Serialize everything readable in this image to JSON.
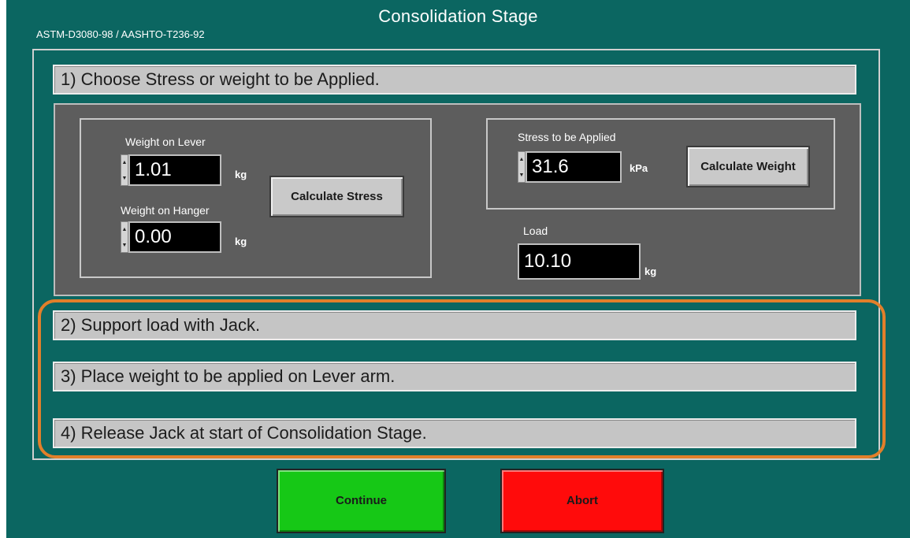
{
  "window": {
    "title": "Consolidation Stage",
    "standard": "ASTM-D3080-98 / AASHTO-T236-92"
  },
  "steps": [
    "1) Choose Stress or weight to be Applied.",
    "2) Support load with Jack.",
    "3) Place weight to be applied on Lever arm.",
    "4) Release Jack at start of Consolidation Stage."
  ],
  "weight_group": {
    "weight_on_lever_label": "Weight on Lever",
    "weight_on_lever_value": "1.01",
    "weight_on_lever_unit": "kg",
    "weight_on_hanger_label": "Weight on Hanger",
    "weight_on_hanger_value": "0.00",
    "weight_on_hanger_unit": "kg",
    "calculate_stress_label": "Calculate Stress"
  },
  "stress_group": {
    "stress_label": "Stress to be Applied",
    "stress_value": "31.6",
    "stress_unit": "kPa",
    "calculate_weight_label": "Calculate Weight"
  },
  "load": {
    "label": "Load",
    "value": "10.10",
    "unit": "kg"
  },
  "actions": {
    "continue_label": "Continue",
    "abort_label": "Abort"
  },
  "colors": {
    "window_bg": "#0b6661",
    "panel_bg": "#5d5d5d",
    "highlight": "#e27f2a",
    "continue": "#16c816",
    "abort": "#ff0b0b"
  }
}
